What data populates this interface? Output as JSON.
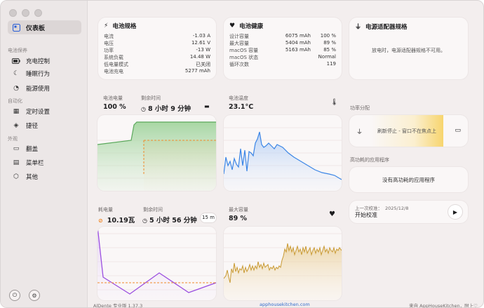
{
  "sidebar": {
    "selected": {
      "label": "仪表板",
      "icon": "dashboard-icon"
    },
    "groups": [
      {
        "title": "电池保养",
        "items": [
          {
            "label": "充电控制",
            "icon": "battery-icon"
          },
          {
            "label": "睡眠行为",
            "icon": "moon-icon"
          },
          {
            "label": "能源使用",
            "icon": "gauge-icon"
          }
        ]
      },
      {
        "title": "自动化",
        "items": [
          {
            "label": "定时设置",
            "icon": "calendar-icon"
          },
          {
            "label": "捷径",
            "icon": "layers-icon"
          }
        ]
      },
      {
        "title": "外观",
        "items": [
          {
            "label": "翻盖",
            "icon": "laptop-icon"
          },
          {
            "label": "菜单栏",
            "icon": "menubar-icon"
          },
          {
            "label": "其他",
            "icon": "cube-icon"
          }
        ]
      }
    ]
  },
  "spec": {
    "title": "电池规格",
    "rows": [
      {
        "k": "电流",
        "v": "-1.03 A"
      },
      {
        "k": "电压",
        "v": "12.61 V"
      },
      {
        "k": "功率",
        "v": "-13 W"
      },
      {
        "k": "系统负载",
        "v": "14.48 W"
      },
      {
        "k": "低电量模式",
        "v": "已关闭"
      },
      {
        "k": "电池充电",
        "v": "5277 mAh"
      }
    ]
  },
  "health": {
    "title": "电池健康",
    "rows": [
      {
        "k": "设计容量",
        "v": "6075 mAh",
        "p": "100 %"
      },
      {
        "k": "最大容量",
        "v": "5404 mAh",
        "p": "89 %"
      },
      {
        "k": "macOS 容量",
        "v": "5163 mAh",
        "p": "85 %"
      },
      {
        "k": "macOS 状态",
        "v": "Normal",
        "p": ""
      },
      {
        "k": "循环次数",
        "v": "119",
        "p": ""
      }
    ]
  },
  "adapter": {
    "title": "电源适配器规格",
    "message": "放电时，电源适配器规格不可用。"
  },
  "battery_level": {
    "label1": "电池电量",
    "value1": "100 %",
    "label2": "剩余时间",
    "value2": "8 小时 9 分钟"
  },
  "temperature": {
    "label": "电池温度",
    "value": "23.1°C"
  },
  "power_dist": {
    "title": "功率分配",
    "message": "刷新停止 - 窗口不在焦点上"
  },
  "top_apps": {
    "title": "高功耗的应用程序",
    "message": "没有高功耗的应用程序"
  },
  "calibration": {
    "last_label": "上一次校准：",
    "last_date": "2025/12/8",
    "action": "开始校准"
  },
  "consumption": {
    "label1": "耗电量",
    "value1": "10.19瓦",
    "label2": "剩余时间",
    "value2": "5 小时 56 分钟",
    "range": "15 m"
  },
  "max_capacity": {
    "label": "最大容量",
    "value": "89 %"
  },
  "status": {
    "left": "AlDente 专业版 1.37.3",
    "center": "apphousekitchen.com",
    "right": "来自 AppHouseKitchen，附上♡"
  }
}
